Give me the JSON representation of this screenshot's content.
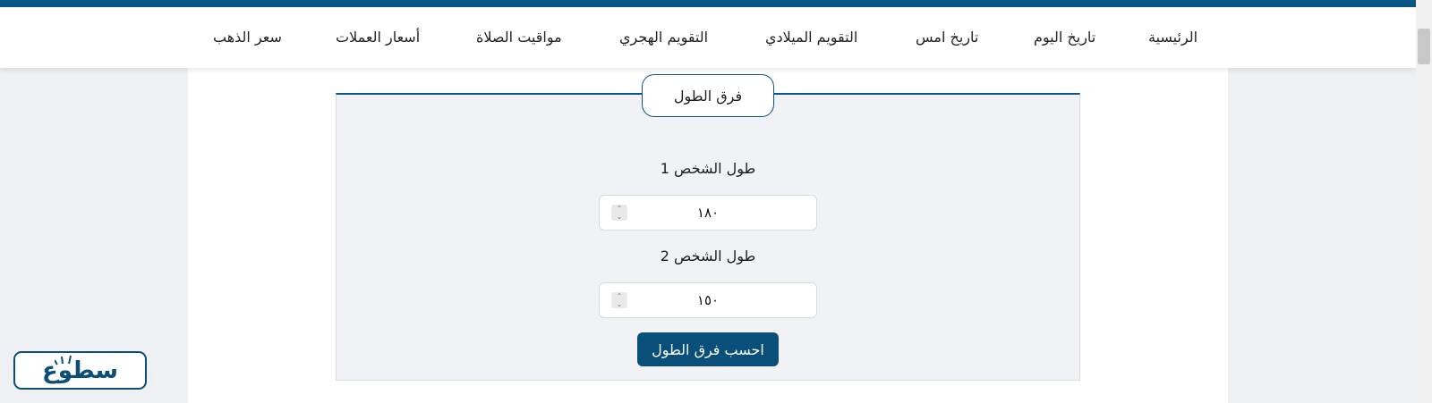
{
  "nav": {
    "items": [
      {
        "label": "الرئيسية"
      },
      {
        "label": "تاريخ اليوم"
      },
      {
        "label": "تاريخ امس"
      },
      {
        "label": "التقويم الميلادي"
      },
      {
        "label": "التقويم الهجري"
      },
      {
        "label": "مواقيت الصلاة"
      },
      {
        "label": "أسعار العملات"
      },
      {
        "label": "سعر الذهب"
      }
    ]
  },
  "calculator": {
    "title": "فرق الطول",
    "person1_label": "طول الشخص 1",
    "person1_value": "١٨٠",
    "person2_label": "طول الشخص 2",
    "person2_value": "١٥٠",
    "button_label": "احسب فرق الطول"
  },
  "logo": {
    "text": "سطوع"
  },
  "colors": {
    "brand": "#0a5688",
    "button": "#0a4f7a",
    "background": "#eef0f4"
  },
  "icons": {
    "spinner": "spinner-arrows-icon",
    "logo_rays": "sun-rays-icon"
  }
}
